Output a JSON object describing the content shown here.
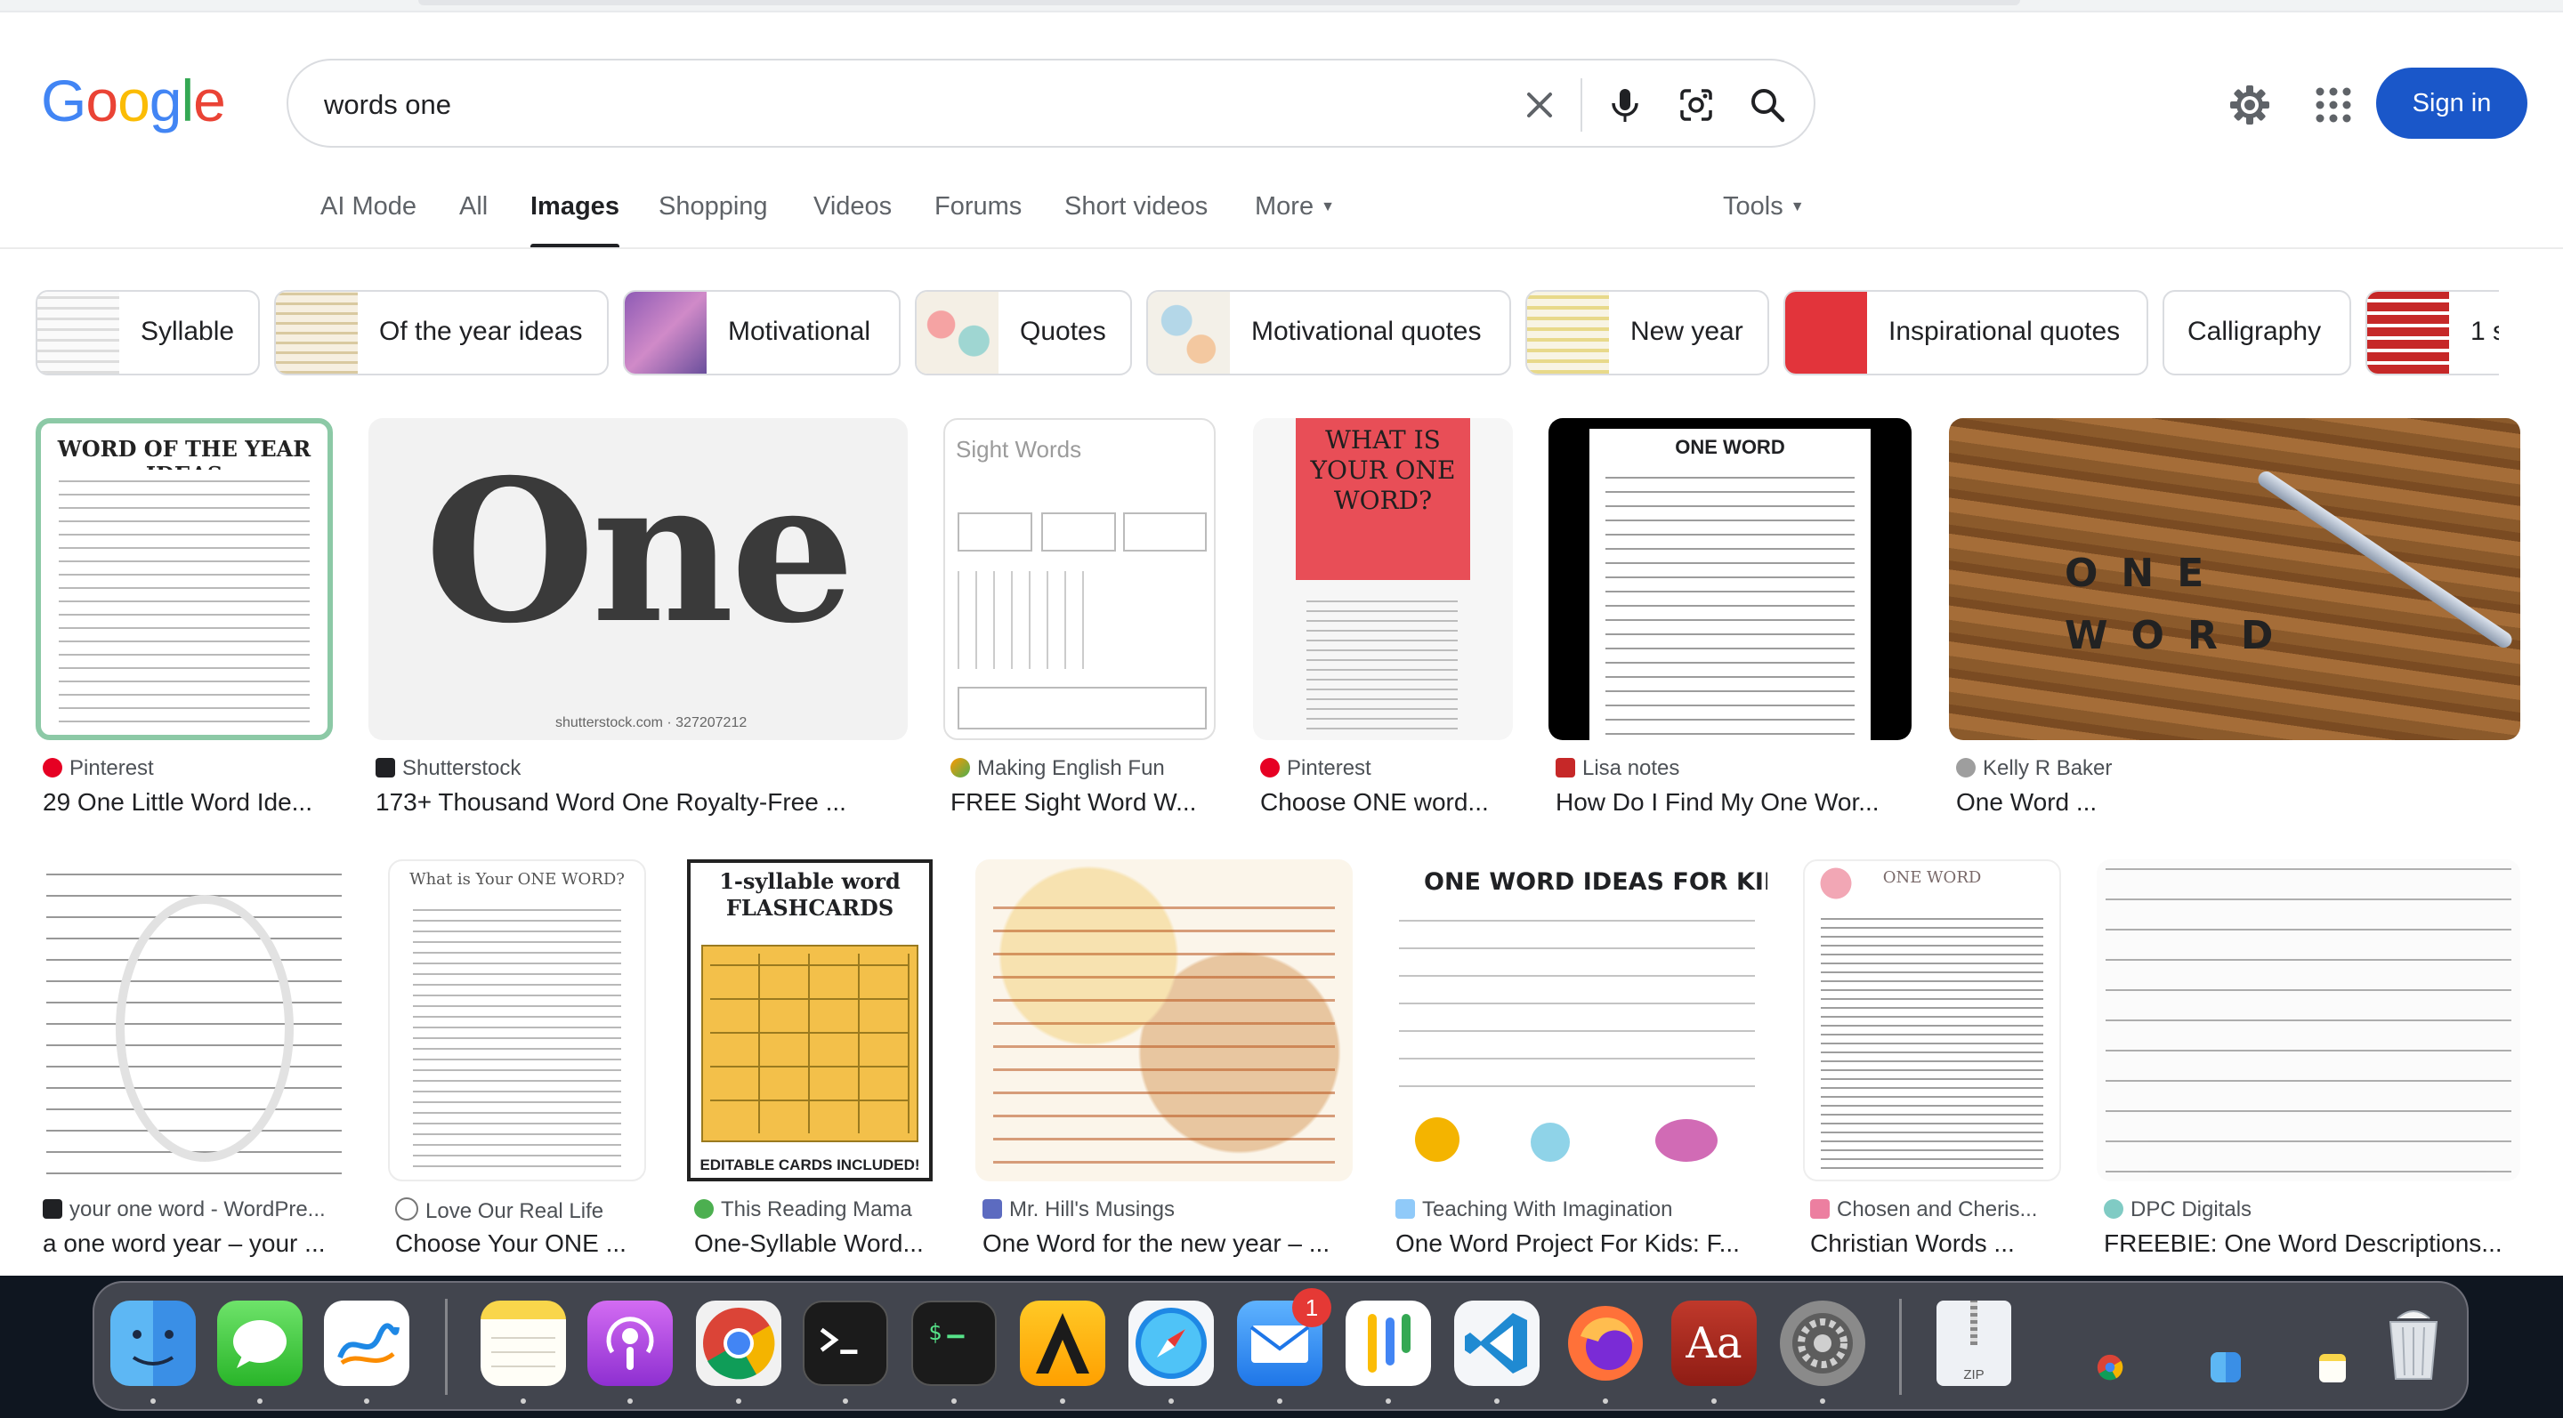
{
  "search": {
    "query": "words one",
    "placeholder": ""
  },
  "header": {
    "sign_in_label": "Sign in"
  },
  "tabs": [
    {
      "label": "AI Mode"
    },
    {
      "label": "All"
    },
    {
      "label": "Images"
    },
    {
      "label": "Shopping"
    },
    {
      "label": "Videos"
    },
    {
      "label": "Forums"
    },
    {
      "label": "Short videos"
    },
    {
      "label": "More"
    }
  ],
  "tools_label": "Tools",
  "chips": [
    {
      "label": "Syllable"
    },
    {
      "label": "Of the year ideas"
    },
    {
      "label": "Motivational"
    },
    {
      "label": "Quotes"
    },
    {
      "label": "Motivational quotes"
    },
    {
      "label": "New year"
    },
    {
      "label": "Inspirational quotes"
    },
    {
      "label": "Calligraphy"
    },
    {
      "label": "1 s"
    }
  ],
  "results_row1": [
    {
      "source": "Pinterest",
      "title": "29 One Little Word Ide...",
      "img_text": "WORD OF THE YEAR IDEAS"
    },
    {
      "source": "Shutterstock",
      "title": "173+ Thousand Word One Royalty-Free ...",
      "img_text": "One",
      "watermark": "shutterstock.com · 327207212"
    },
    {
      "source": "Making English Fun",
      "title": "FREE Sight Word W...",
      "img_text": "Sight Words"
    },
    {
      "source": "Pinterest",
      "title": "Choose ONE word...",
      "img_text": "WHAT IS YOUR ONE WORD?"
    },
    {
      "source": "Lisa notes",
      "title": "How Do I Find My One Wor...",
      "img_text": "ONE WORD"
    },
    {
      "source": "Kelly R Baker",
      "title": "One Word ...",
      "img_text": "ONE WORD"
    }
  ],
  "results_row2": [
    {
      "source": "your one word - WordPre...",
      "title": "a one word year – your ...",
      "img_text": ""
    },
    {
      "source": "Love Our Real Life",
      "title": "Choose Your ONE ...",
      "img_text": "What is Your ONE WORD?"
    },
    {
      "source": "This Reading Mama",
      "title": "One-Syllable Word...",
      "img_text": "1-syllable word FLASHCARDS",
      "img_footer": "EDITABLE CARDS INCLUDED!"
    },
    {
      "source": "Mr. Hill's Musings",
      "title": "One Word for the new year – ...",
      "img_text": ""
    },
    {
      "source": "Teaching With Imagination",
      "title": "One Word Project For Kids: F...",
      "img_text": "ONE WORD IDEAS FOR KID"
    },
    {
      "source": "Chosen and Cheris...",
      "title": "Christian Words ...",
      "img_text": "ONE WORD"
    },
    {
      "source": "DPC Digitals",
      "title": "FREEBIE: One Word Descriptions...",
      "img_text": ""
    }
  ],
  "dock": {
    "mail_badge": "1",
    "apps": [
      "Finder",
      "Messages",
      "Freeform",
      "Notes",
      "Podcasts",
      "Chrome",
      "Terminal",
      "Terminal 2",
      "Vectorize",
      "Safari",
      "Mail",
      "Pinwheel",
      "VS Code",
      "Firefox",
      "Dictionary",
      "System Settings",
      "Archive",
      "Chrome recent",
      "Finder recent",
      "Notes recent",
      "Trash"
    ],
    "dictionary_glyph": "Aa",
    "archive_label": "ZIP"
  },
  "colors": {
    "accent": "#1a57c9",
    "google_blue": "#4285f4",
    "google_red": "#ea4335",
    "google_yellow": "#fbbc05",
    "google_green": "#34a853"
  }
}
